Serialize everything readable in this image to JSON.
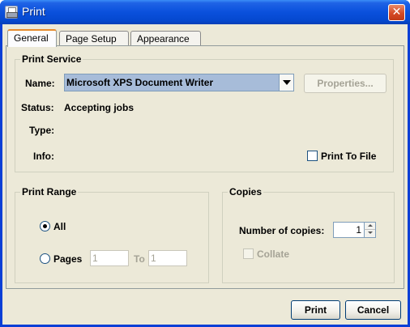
{
  "window": {
    "title": "Print",
    "close_glyph": "✕"
  },
  "tabs": [
    {
      "label": "General"
    },
    {
      "label": "Page Setup"
    },
    {
      "label": "Appearance"
    }
  ],
  "print_service": {
    "title": "Print Service",
    "name_label": "Name:",
    "printer": "Microsoft XPS Document Writer",
    "properties_label": "Properties...",
    "status_label": "Status:",
    "status_value": "Accepting jobs",
    "type_label": "Type:",
    "info_label": "Info:",
    "print_to_file_label": "Print To File"
  },
  "print_range": {
    "title": "Print Range",
    "all_label": "All",
    "pages_label": "Pages",
    "from_value": "1",
    "to_label": "To",
    "to_value": "1"
  },
  "copies": {
    "title": "Copies",
    "number_label": "Number of copies:",
    "number_value": "1",
    "collate_label": "Collate"
  },
  "footer": {
    "print_label": "Print",
    "cancel_label": "Cancel"
  },
  "colors": {
    "title_bar": "#0a50dc",
    "dialog_bg": "#ece9d8",
    "tab_highlight": "#e68b2c",
    "selected_combo": "#a7bcd9"
  },
  "icons": {
    "window": "printer-icon",
    "close": "close-icon"
  }
}
